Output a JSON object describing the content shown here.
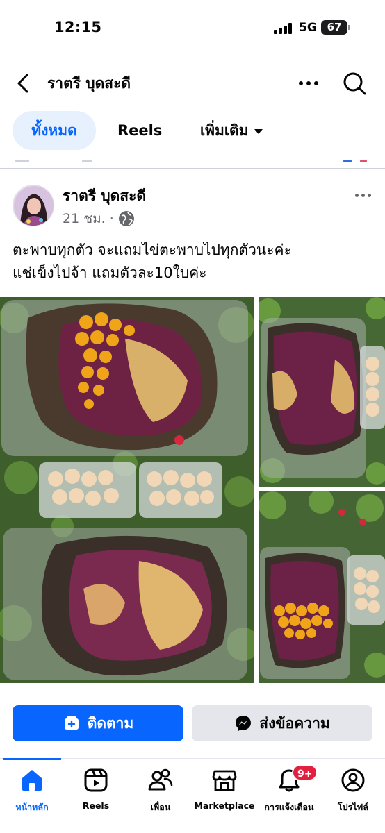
{
  "status_bar": {
    "time": "12:15",
    "network": "5G",
    "battery": "67"
  },
  "header": {
    "title": "ราตรี บุดสะดี"
  },
  "tabs": [
    {
      "label": "ทั้งหมด",
      "active": true
    },
    {
      "label": "Reels",
      "active": false
    },
    {
      "label": "เพิ่มเติม",
      "active": false
    }
  ],
  "post": {
    "author": "ราตรี บุดสะดี",
    "time": "21 ชม.",
    "separator": "·",
    "text_line1": "ตะพาบทุกตัว จะแถมไข่ตะพาบไปทุกตัวนะค่ะ",
    "text_line2": "แช่เข็งไปจ้า แถมตัวละ10ใบค่ะ",
    "photo_count": 3
  },
  "actions": {
    "follow": "ติดตาม",
    "message": "ส่งข้อความ"
  },
  "bottom_nav": [
    {
      "label": "หน้าหลัก",
      "icon": "home-icon",
      "active": true
    },
    {
      "label": "Reels",
      "icon": "reels-icon",
      "active": false
    },
    {
      "label": "เพื่อน",
      "icon": "friends-icon",
      "active": false
    },
    {
      "label": "Marketplace",
      "icon": "marketplace-icon",
      "active": false
    },
    {
      "label": "การแจ้งเตือน",
      "icon": "bell-icon",
      "active": false,
      "badge": "9+"
    },
    {
      "label": "โปรไฟล์",
      "icon": "profile-icon",
      "active": false
    }
  ],
  "colors": {
    "accent": "#0866ff",
    "badge": "#e41e3f",
    "secondary_button": "#e4e6eb"
  }
}
